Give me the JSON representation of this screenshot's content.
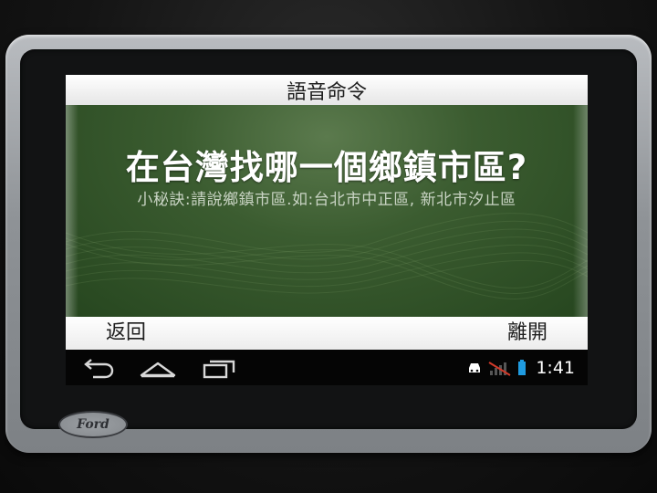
{
  "device": {
    "brand": "Ford"
  },
  "screen": {
    "title": "語音命令",
    "question": "在台灣找哪一個鄉鎮市區?",
    "hint": "小秘訣:請說鄉鎮市區.如:台北市中正區, 新北市汐止區",
    "back_label": "返回",
    "exit_label": "離開"
  },
  "navbar": {
    "icons": [
      "back-arrow-icon",
      "home-icon",
      "recent-apps-icon"
    ]
  },
  "status": {
    "icons": [
      "car-icon",
      "no-signal-icon",
      "battery-icon"
    ],
    "time": "1:41"
  },
  "colors": {
    "accent_battery": "#1f9be0",
    "no_signal": "#d23a2a",
    "background_green": "#3b5c30"
  }
}
